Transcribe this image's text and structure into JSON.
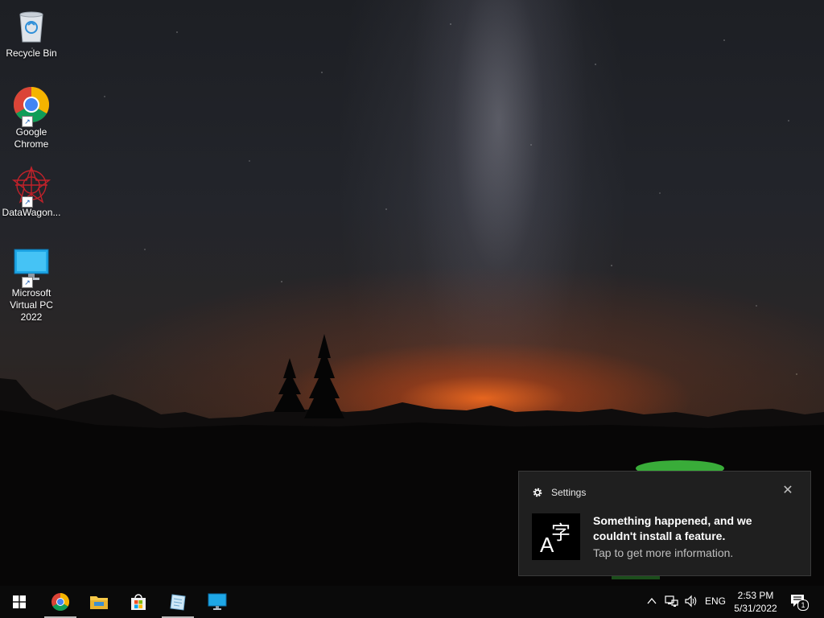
{
  "desktop": {
    "icons": [
      {
        "label": "Recycle Bin"
      },
      {
        "label": "Google Chrome"
      },
      {
        "label": "DataWagon..."
      },
      {
        "label": "Microsoft Virtual PC 2022"
      }
    ]
  },
  "toast": {
    "app_name": "Settings",
    "title": "Something happened, and we couldn't install a feature.",
    "body": "Tap to get more information.",
    "icon": "language-feature-icon",
    "icon_glyph_latin": "A",
    "icon_glyph_cjk": "字"
  },
  "taskbar": {
    "pinned": [
      {
        "name": "start-button",
        "icon": "windows-logo-icon"
      },
      {
        "name": "chrome",
        "icon": "chrome-icon"
      },
      {
        "name": "file-explorer",
        "icon": "folder-icon"
      },
      {
        "name": "store",
        "icon": "store-bag-icon"
      },
      {
        "name": "app-4",
        "icon": "notepad-icon"
      },
      {
        "name": "app-5",
        "icon": "monitor-icon"
      }
    ],
    "tray": {
      "language": "ENG",
      "time": "2:53 PM",
      "date": "5/31/2022",
      "notification_count": "1"
    }
  },
  "colors": {
    "taskbar_bg": "#0a0a0a",
    "toast_bg": "#1f1f1f",
    "chrome_red": "#db4437",
    "chrome_green": "#0f9d58",
    "chrome_yellow": "#f4b400",
    "chrome_blue": "#4285f4"
  }
}
